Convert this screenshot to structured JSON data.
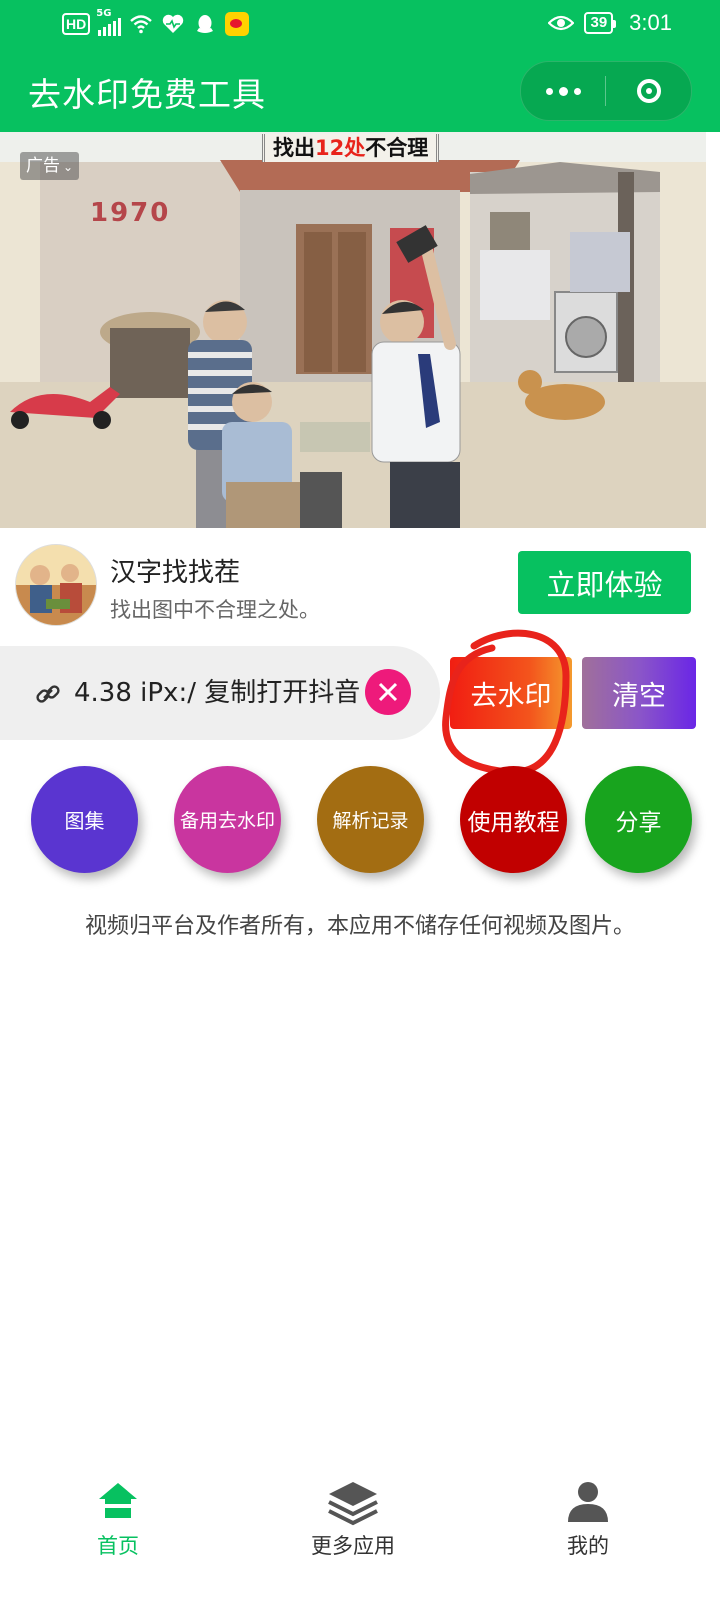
{
  "status_bar": {
    "hd": "HD",
    "network": "5G",
    "battery": "39",
    "time": "3:01",
    "icons": [
      "signal-icon",
      "wifi-icon",
      "heart-icon",
      "qq-icon",
      "weibo-icon",
      "eye-icon",
      "battery-icon"
    ]
  },
  "nav": {
    "title": "去水印免费工具",
    "more_icon": "more-dots-icon",
    "close_icon": "target-circle-icon"
  },
  "ad": {
    "caption_prefix": "找出",
    "caption_number": "12",
    "caption_highlight": "处",
    "caption_suffix": "不合理",
    "tag": "广告",
    "year_sign": "1970",
    "app_name": "汉字找找茬",
    "description": "找出图中不合理之处。",
    "cta": "立即体验"
  },
  "input": {
    "value": "4.38 iPx:/ 复制打开抖音",
    "link_icon": "link-icon",
    "clear_icon": "clear-x-icon"
  },
  "actions": {
    "remove_watermark": "去水印",
    "clear": "清空"
  },
  "circles": [
    "图集",
    "备用去水印",
    "解析记录",
    "使用教程",
    "分享"
  ],
  "disclaimer": "视频归平台及作者所有，本应用不储存任何视频及图片。",
  "tabs": [
    {
      "label": "首页",
      "icon": "home-icon",
      "active": true
    },
    {
      "label": "更多应用",
      "icon": "layers-icon",
      "active": false
    },
    {
      "label": "我的",
      "icon": "user-icon",
      "active": false
    }
  ],
  "colors": {
    "brand_green": "#07c160",
    "annotation_red": "#e8231b"
  }
}
